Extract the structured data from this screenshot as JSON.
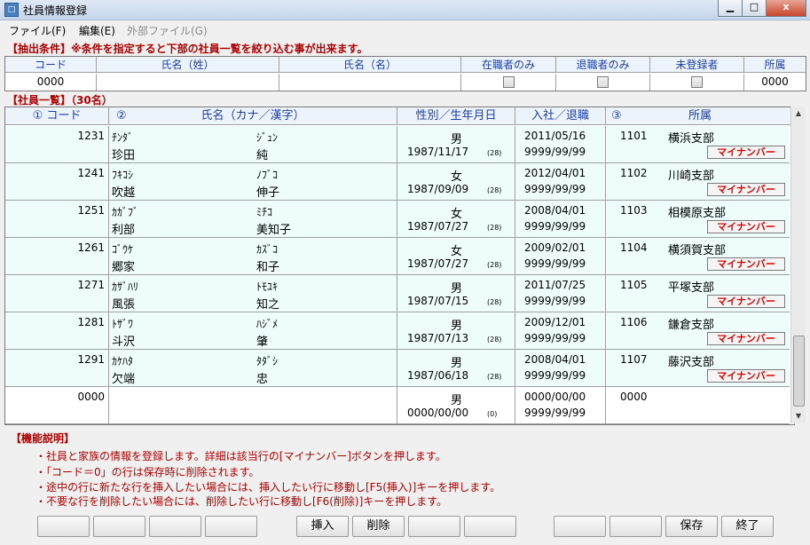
{
  "window": {
    "title": "社員情報登録",
    "icon": "app-icon",
    "close_glyph": "x"
  },
  "menu": [
    {
      "label": "ファイル(F)",
      "enabled": true
    },
    {
      "label": "編集(E)",
      "enabled": true
    },
    {
      "label": "外部ファイル(G)",
      "enabled": false
    }
  ],
  "filter": {
    "heading": "【抽出条件】※条件を指定すると下部の社員一覧を絞り込む事が出来ます。",
    "columns": [
      "コード",
      "氏名（姓）",
      "氏名（名）",
      "在職者のみ",
      "退職者のみ",
      "未登録者",
      "所属"
    ],
    "values": {
      "code": "0000",
      "last_name": "",
      "first_name": "",
      "affiliation": "0000"
    }
  },
  "list": {
    "heading": "【社員一覧】（30名）",
    "columns": [
      "① コード",
      "②",
      "氏名（カナ／漢字）",
      "性別／生年月日",
      "入社／退職",
      "③",
      "所属"
    ],
    "mynumber_label": "マイナンバー",
    "rows": [
      {
        "code": "1231",
        "kana_last": "ﾁﾝﾀﾞ",
        "kana_first": "ｼﾞｭﾝ",
        "kanji_last": "珍田",
        "kanji_first": "純",
        "gender": "男",
        "birth": "1987/11/17",
        "age": "(28)",
        "join": "2011/05/16",
        "leave": "9999/99/99",
        "aff_code": "1101",
        "aff_name": "横浜支部"
      },
      {
        "code": "1241",
        "kana_last": "ﾌｷｺｼ",
        "kana_first": "ﾉﾌﾞｺ",
        "kanji_last": "吹越",
        "kanji_first": "伸子",
        "gender": "女",
        "birth": "1987/09/09",
        "age": "(28)",
        "join": "2012/04/01",
        "leave": "9999/99/99",
        "aff_code": "1102",
        "aff_name": "川崎支部"
      },
      {
        "code": "1251",
        "kana_last": "ｶｶﾞﾌﾞ",
        "kana_first": "ﾐﾁｺ",
        "kanji_last": "利部",
        "kanji_first": "美知子",
        "gender": "女",
        "birth": "1987/07/27",
        "age": "(28)",
        "join": "2008/04/01",
        "leave": "9999/99/99",
        "aff_code": "1103",
        "aff_name": "相模原支部"
      },
      {
        "code": "1261",
        "kana_last": "ｺﾞｳｹ",
        "kana_first": "ｶｽﾞｺ",
        "kanji_last": "郷家",
        "kanji_first": "和子",
        "gender": "女",
        "birth": "1987/07/27",
        "age": "(28)",
        "join": "2009/02/01",
        "leave": "9999/99/99",
        "aff_code": "1104",
        "aff_name": "横須賀支部"
      },
      {
        "code": "1271",
        "kana_last": "ｶｻﾞﾊﾘ",
        "kana_first": "ﾄﾓﾕｷ",
        "kanji_last": "風張",
        "kanji_first": "知之",
        "gender": "男",
        "birth": "1987/07/15",
        "age": "(28)",
        "join": "2011/07/25",
        "leave": "9999/99/99",
        "aff_code": "1105",
        "aff_name": "平塚支部"
      },
      {
        "code": "1281",
        "kana_last": "ﾄｻﾞﾜ",
        "kana_first": "ﾊｼﾞﾒ",
        "kanji_last": "斗沢",
        "kanji_first": "肇",
        "gender": "男",
        "birth": "1987/07/13",
        "age": "(28)",
        "join": "2009/12/01",
        "leave": "9999/99/99",
        "aff_code": "1106",
        "aff_name": "鎌倉支部"
      },
      {
        "code": "1291",
        "kana_last": "ｶｹﾊﾀ",
        "kana_first": "ﾀﾀﾞｼ",
        "kanji_last": "欠端",
        "kanji_first": "忠",
        "gender": "男",
        "birth": "1987/06/18",
        "age": "(28)",
        "join": "2008/04/01",
        "leave": "9999/99/99",
        "aff_code": "1107",
        "aff_name": "藤沢支部"
      },
      {
        "code": "0000",
        "kana_last": "",
        "kana_first": "",
        "kanji_last": "",
        "kanji_first": "",
        "gender": "男",
        "birth": "0000/00/00",
        "age": "(0)",
        "join": "0000/00/00",
        "leave": "9999/99/99",
        "aff_code": "0000",
        "aff_name": ""
      }
    ]
  },
  "help": {
    "heading": "【機能説明】",
    "lines": [
      "・社員と家族の情報を登録します。詳細は該当行の[マイナンバー]ボタンを押します。",
      "・「コード＝0」の行は保存時に削除されます。",
      "・途中の行に新たな行を挿入したい場合には、挿入したい行に移動し[F5(挿入)]キーを押します。",
      "・不要な行を削除したい場合には、削除したい行に移動し[F6(削除)]キーを押します。"
    ]
  },
  "fkeys": [
    "",
    "",
    "",
    "",
    "挿入",
    "削除",
    "",
    "",
    "",
    "",
    "保存",
    "終了"
  ]
}
